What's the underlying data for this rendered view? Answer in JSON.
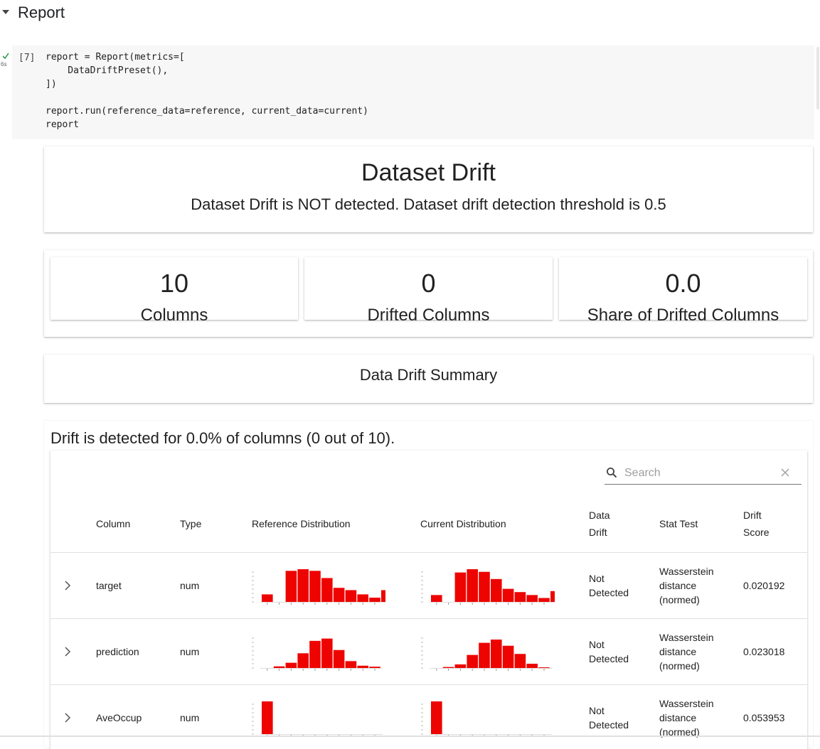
{
  "section": {
    "title": "Report"
  },
  "cell": {
    "exec_count": "[7]",
    "runtime": "6s",
    "code_lines": [
      "report = Report(metrics=[",
      "    DataDriftPreset(),",
      "])",
      "",
      "report.run(reference_data=reference, current_data=current)",
      "report"
    ]
  },
  "drift_card": {
    "title": "Dataset Drift",
    "subtitle": "Dataset Drift is NOT detected. Dataset drift detection threshold is 0.5"
  },
  "metrics": [
    {
      "value": "10",
      "label": "Columns"
    },
    {
      "value": "0",
      "label": "Drifted Columns"
    },
    {
      "value": "0.0",
      "label": "Share of Drifted Columns"
    }
  ],
  "summary": {
    "title": "Data Drift Summary",
    "detected_text": "Drift is detected for 0.0% of columns (0 out of 10)."
  },
  "search": {
    "placeholder": "Search"
  },
  "table": {
    "headers": {
      "column": "Column",
      "type": "Type",
      "reference": "Reference Distribution",
      "current": "Current Distribution",
      "data_drift_1": "Data",
      "data_drift_2": "Drift",
      "stat_test": "Stat Test",
      "drift_score_1": "Drift",
      "drift_score_2": "Score"
    },
    "rows": [
      {
        "column": "target",
        "type": "num",
        "drift_1": "Not",
        "drift_2": "Detected",
        "stat_1": "Wasserstein",
        "stat_2": "distance",
        "stat_3": "(normed)",
        "score": "0.020192"
      },
      {
        "column": "prediction",
        "type": "num",
        "drift_1": "Not",
        "drift_2": "Detected",
        "stat_1": "Wasserstein",
        "stat_2": "distance",
        "stat_3": "(normed)",
        "score": "0.023018"
      },
      {
        "column": "AveOccup",
        "type": "num",
        "drift_1": "Not",
        "drift_2": "Detected",
        "stat_1": "Wasserstein",
        "stat_2": "distance",
        "stat_3": "(normed)",
        "score": "0.053953"
      }
    ]
  },
  "histograms": {
    "color": "#ed0400",
    "rows": [
      {
        "reference": [
          0.23,
          0.0,
          0.95,
          1.0,
          0.95,
          0.73,
          0.43,
          0.36,
          0.23,
          0.13,
          0.36
        ],
        "current": [
          0.21,
          0.0,
          0.9,
          1.0,
          0.92,
          0.7,
          0.4,
          0.3,
          0.21,
          0.12,
          0.33
        ]
      },
      {
        "reference": [
          0.0,
          0.05,
          0.16,
          0.45,
          0.83,
          0.9,
          0.55,
          0.21,
          0.07,
          0.04
        ],
        "current": [
          0.0,
          0.03,
          0.11,
          0.4,
          0.77,
          0.87,
          0.68,
          0.43,
          0.13,
          0.02
        ]
      },
      {
        "reference": [
          1.0,
          0,
          0,
          0,
          0,
          0,
          0,
          0,
          0,
          0
        ],
        "current": [
          1.0,
          0,
          0,
          0,
          0,
          0,
          0,
          0,
          0,
          0
        ]
      }
    ]
  },
  "colors": {
    "accent_red": "#ed0400",
    "check_green": "#1e8e3e"
  },
  "icons": [
    "caret-down-icon",
    "check-icon",
    "search-icon",
    "clear-icon",
    "chevron-right-icon"
  ]
}
